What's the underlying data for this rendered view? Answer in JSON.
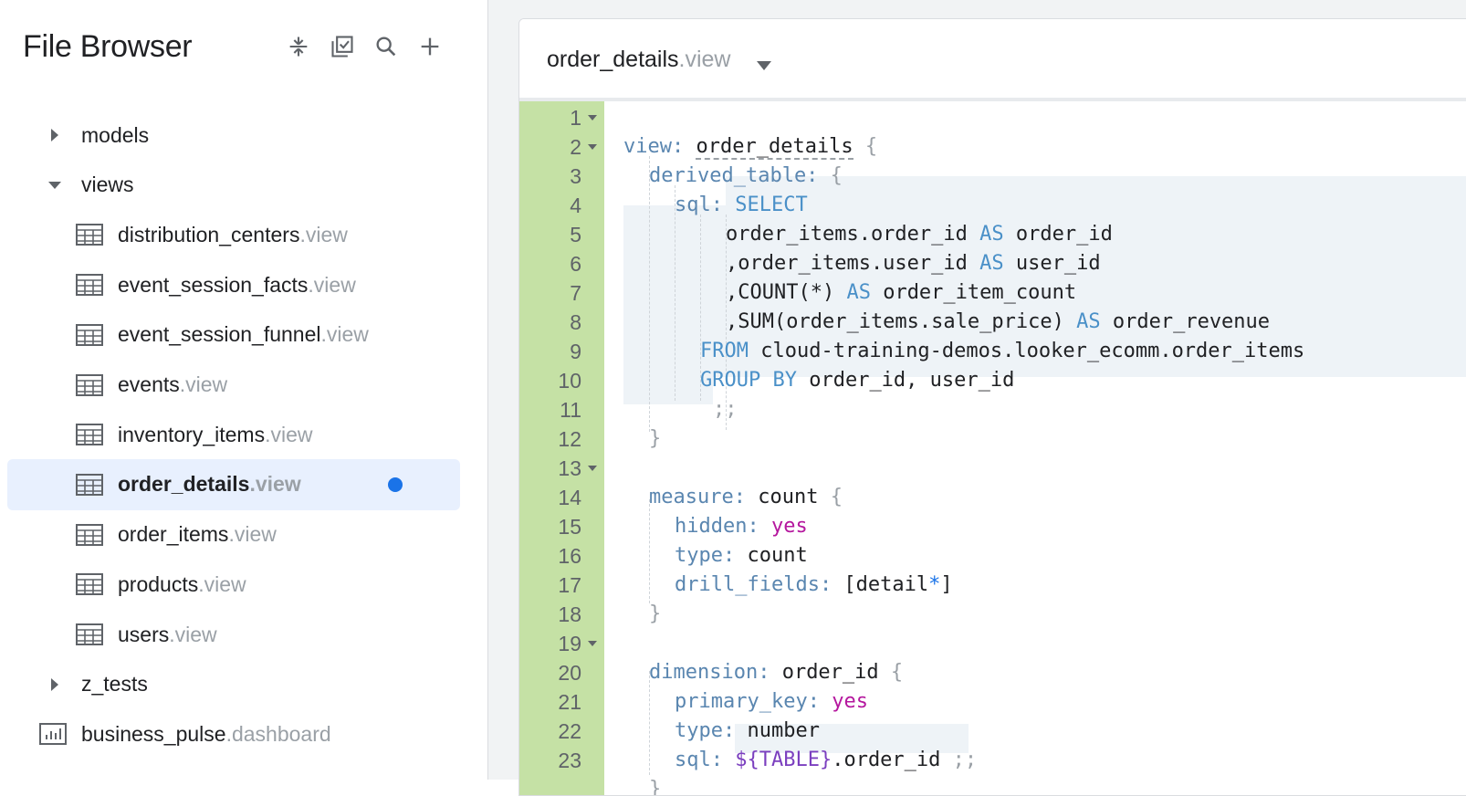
{
  "sidebar": {
    "title": "File Browser",
    "tools": [
      "collapse-all-icon",
      "select-files-icon",
      "search-icon",
      "add-icon"
    ],
    "folders": {
      "models": "models",
      "views": "views",
      "z_tests": "z_tests"
    },
    "view_files": [
      {
        "name": "distribution_centers",
        "ext": ".view"
      },
      {
        "name": "event_session_facts",
        "ext": ".view"
      },
      {
        "name": "event_session_funnel",
        "ext": ".view"
      },
      {
        "name": "events",
        "ext": ".view"
      },
      {
        "name": "inventory_items",
        "ext": ".view"
      },
      {
        "name": "order_details",
        "ext": ".view",
        "selected": true,
        "unsaved": true
      },
      {
        "name": "order_items",
        "ext": ".view"
      },
      {
        "name": "products",
        "ext": ".view"
      },
      {
        "name": "users",
        "ext": ".view"
      }
    ],
    "dashboard_file": {
      "name": "business_pulse",
      "ext": ".dashboard"
    }
  },
  "editor": {
    "tab": {
      "name": "order_details",
      "ext": ".view"
    },
    "line_numbers": [
      "1",
      "2",
      "3",
      "4",
      "5",
      "6",
      "7",
      "8",
      "9",
      "10",
      "11",
      "12",
      "13",
      "14",
      "15",
      "16",
      "17",
      "18",
      "19",
      "20",
      "21",
      "22",
      "23"
    ],
    "code": {
      "l1": {
        "a": "view:",
        "b": "order_details",
        "c": " {"
      },
      "l2": {
        "a": "derived_table:",
        "c": " {"
      },
      "l3": {
        "a": "sql:",
        "b": " SELECT"
      },
      "l4": {
        "a": "order_items.order_id ",
        "b": "AS",
        "c": " order_id"
      },
      "l5": {
        "a": ",order_items.user_id ",
        "b": "AS",
        "c": " user_id"
      },
      "l6": {
        "a": ",COUNT(*) ",
        "b": "AS",
        "c": " order_item_count"
      },
      "l7": {
        "a": ",SUM(order_items.sale_price) ",
        "b": "AS",
        "c": " order_revenue"
      },
      "l8": {
        "a": "FROM",
        "b": " cloud-training-demos.looker_ecomm.order_items"
      },
      "l9": {
        "a": "GROUP BY",
        "b": " order_id, user_id"
      },
      "l10": {
        "a": ";;"
      },
      "l11": {
        "a": "}"
      },
      "l13": {
        "a": "measure:",
        "b": " count",
        "c": " {"
      },
      "l14": {
        "a": "hidden:",
        "b": " yes"
      },
      "l15": {
        "a": "type:",
        "b": " count"
      },
      "l16": {
        "a": "drill_fields:",
        "b": " [detail",
        "c": "*",
        "d": "]"
      },
      "l17": {
        "a": "}"
      },
      "l19": {
        "a": "dimension:",
        "b": " order_id",
        "c": " {"
      },
      "l20": {
        "a": "primary_key:",
        "b": " yes"
      },
      "l21": {
        "a": "type:",
        "b": " number"
      },
      "l22": {
        "a": "sql:",
        "b": " ${TABLE}",
        "c": ".order_id ",
        "d": ";;"
      },
      "l23": {
        "a": "}"
      }
    }
  },
  "colors": {
    "accent": "#1a73e8",
    "gutter": "#c5e1a5",
    "selected_row": "#e8f0fe"
  }
}
